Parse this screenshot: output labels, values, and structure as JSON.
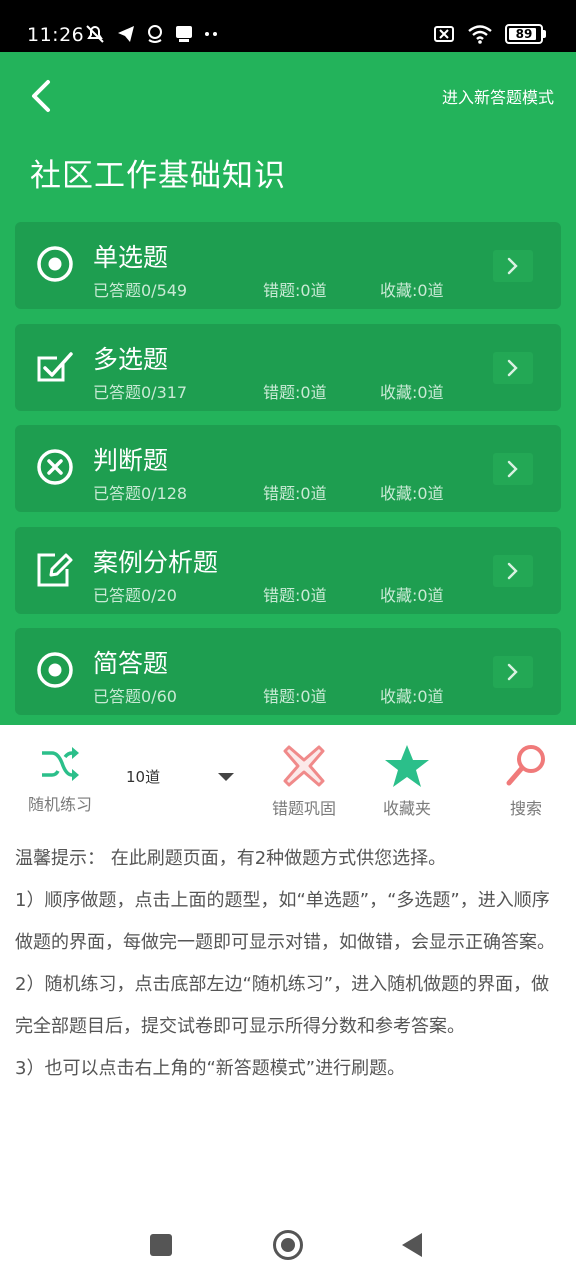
{
  "status_bar": {
    "time": "11:26",
    "battery": "89",
    "battery_level": 0.89
  },
  "header": {
    "back_icon": "chevron-left-icon",
    "mode_link": "进入新答题模式",
    "title": "社区工作基础知识"
  },
  "categories": [
    {
      "icon": "radio-target-icon",
      "title": "单选题",
      "answered": "已答题0/549",
      "wrong": "错题:0道",
      "favorites": "收藏:0道"
    },
    {
      "icon": "checkbox-checked-icon",
      "title": "多选题",
      "answered": "已答题0/317",
      "wrong": "错题:0道",
      "favorites": "收藏:0道"
    },
    {
      "icon": "circle-x-icon",
      "title": "判断题",
      "answered": "已答题0/128",
      "wrong": "错题:0道",
      "favorites": "收藏:0道"
    },
    {
      "icon": "edit-document-icon",
      "title": "案例分析题",
      "answered": "已答题0/20",
      "wrong": "错题:0道",
      "favorites": "收藏:0道"
    },
    {
      "icon": "radio-target-icon",
      "title": "简答题",
      "answered": "已答题0/60",
      "wrong": "错题:0道",
      "favorites": "收藏:0道"
    }
  ],
  "toolbar": {
    "random_label": "随机练习",
    "count_value": "10道",
    "wrong_label": "错题巩固",
    "fav_label": "收藏夹",
    "search_label": "搜索"
  },
  "tips": {
    "line1": "温馨提示： 在此刷题页面，有2种做题方式供您选择。",
    "line2": " 1）顺序做题，点击上面的题型，如“单选题”，“多选题”，进入顺序做题的界面，每做完一题即可显示对错，如做错，会显示正确答案。",
    "line3": " 2）随机练习，点击底部左边“随机练习”，进入随机做题的界面，做完全部题目后，提交试卷即可显示所得分数和参考答案。",
    "line4": " 3）也可以点击右上角的“新答题模式”进行刷题。"
  },
  "colors": {
    "primary_green": "#23b35b",
    "card_green": "#1e9e50",
    "accent_teal": "#2bbf8a",
    "wrong_pink": "#f08a8a",
    "search_pink": "#f07a7a"
  }
}
